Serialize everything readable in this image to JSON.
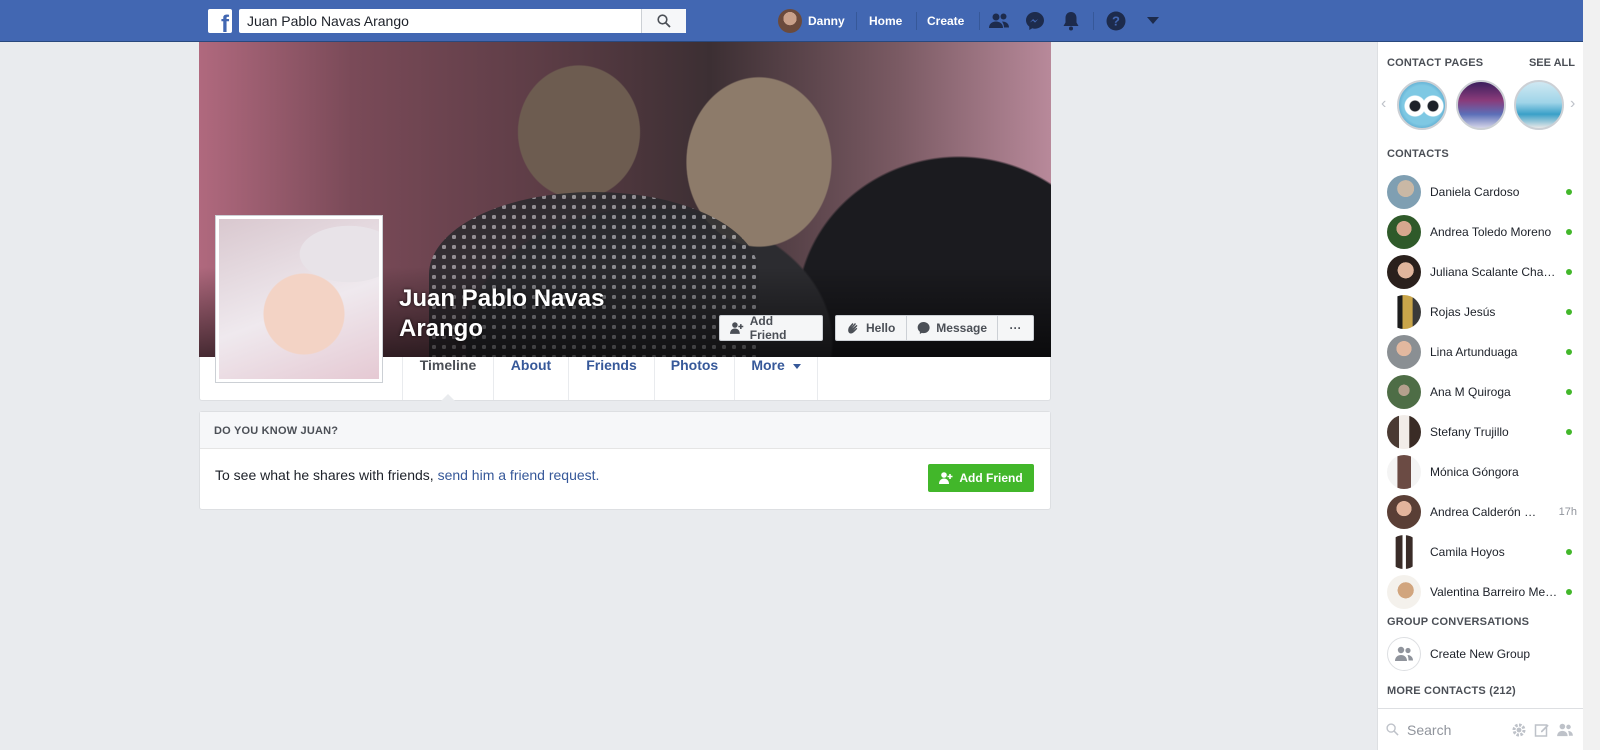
{
  "topbar": {
    "logo": "f",
    "search_value": "Juan Pablo Navas Arango",
    "user_name": "Danny",
    "home_label": "Home",
    "create_label": "Create",
    "icons": [
      "friend-requests-icon",
      "messenger-icon",
      "notifications-icon",
      "help-icon",
      "dropdown-arrow-icon"
    ]
  },
  "profile": {
    "name": "Juan Pablo Navas Arango",
    "buttons": {
      "add_friend": "Add Friend",
      "hello": "Hello",
      "message": "Message",
      "more": "···"
    },
    "tabs": [
      "Timeline",
      "About",
      "Friends",
      "Photos",
      "More"
    ]
  },
  "know": {
    "heading": "DO YOU KNOW JUAN?",
    "text": "To see what he shares with friends, ",
    "link": "send him a friend request.",
    "button": "Add Friend"
  },
  "sidebar": {
    "contact_pages_title": "CONTACT PAGES",
    "see_all": "SEE ALL",
    "contacts_title": "CONTACTS",
    "contacts": [
      {
        "name": "Daniela Cardoso",
        "online": true
      },
      {
        "name": "Andrea Toledo Moreno",
        "online": true
      },
      {
        "name": "Juliana Scalante Chaparro",
        "online": true
      },
      {
        "name": "Rojas Jesús",
        "online": true
      },
      {
        "name": "Lina Artunduaga",
        "online": true
      },
      {
        "name": "Ana M Quiroga",
        "online": true
      },
      {
        "name": "Stefany Trujillo",
        "online": true
      },
      {
        "name": "Mónica Góngora",
        "online": false
      },
      {
        "name": "Andrea Calderón Sánchez",
        "online": false,
        "time": "17h"
      },
      {
        "name": "Camila Hoyos",
        "online": true
      },
      {
        "name": "Valentina Barreiro Mendez",
        "online": true
      }
    ],
    "group_title": "GROUP CONVERSATIONS",
    "create_group": "Create New Group",
    "more_contacts": "MORE CONTACTS (212)",
    "search_placeholder": "Search"
  },
  "colors": {
    "brand": "#4267b2",
    "online": "#42b72a",
    "link": "#365899"
  }
}
